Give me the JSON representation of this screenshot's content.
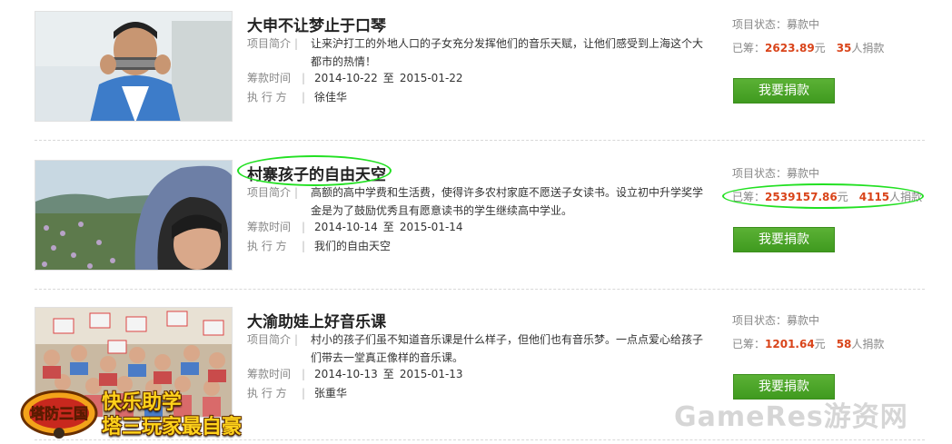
{
  "labels": {
    "intro": "项目简介",
    "period": "筹款时间",
    "executor": "执 行 方",
    "status_prefix": "项目状态：",
    "raised_prefix": "已筹：",
    "currency": "元",
    "donors_suffix": "人捐款",
    "date_to": "至",
    "separator": "|"
  },
  "projects": [
    {
      "title": "大申不让梦止于口琴",
      "intro": "让来沪打工的外地人口的子女充分发挥他们的音乐天赋，让他们感受到上海这个大都市的热情！",
      "start": "2014-10-22",
      "end": "2015-01-22",
      "executor": "徐佳华",
      "status": "募款中",
      "amount": "2623.89",
      "donors": "35",
      "donate_label": "我要捐款",
      "image_icon": "boy-harmonica-photo"
    },
    {
      "title": "村寨孩子的自由天空",
      "intro": "高额的高中学费和生活费，使得许多农村家庭不愿送子女读书。设立初中升学奖学金是为了鼓励优秀且有愿意读书的学生继续高中学业。",
      "start": "2014-10-14",
      "end": "2015-01-14",
      "executor": "我们的自由天空",
      "status": "募款中",
      "amount": "2539157.86",
      "donors": "4115",
      "donate_label": "我要捐款",
      "image_icon": "girl-hood-field-photo"
    },
    {
      "title": "大渝助娃上好音乐课",
      "intro": "村小的孩子们虽不知道音乐课是什么样子，但他们也有音乐梦。一点点爱心给孩子们带去一堂真正像样的音乐课。",
      "start": "2014-10-13",
      "end": "2015-01-13",
      "executor": "张重华",
      "status": "募款中",
      "amount": "1201.64",
      "donors": "58",
      "donate_label": "我要捐款",
      "image_icon": "classroom-kids-photo"
    }
  ],
  "overlay": {
    "logo_text": "塔防三国",
    "promo_line1": "快乐助学",
    "promo_line2": "塔三玩家最自豪",
    "watermark": "GameRes游资网",
    "highlight_color": "#22e022"
  }
}
